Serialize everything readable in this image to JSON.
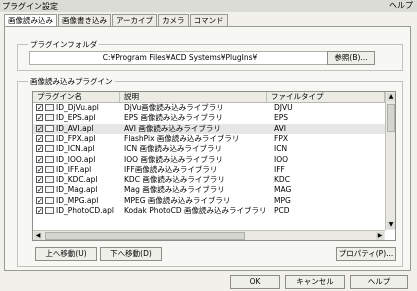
{
  "window": {
    "title": "プラグイン設定",
    "help_label": "ヘルプ"
  },
  "tabs": [
    {
      "label": "画像読み込み"
    },
    {
      "label": "画像書き込み"
    },
    {
      "label": "アーカイブ"
    },
    {
      "label": "カメラ"
    },
    {
      "label": "コマンド"
    }
  ],
  "plugin_folder": {
    "caption": "プラグインフォルダ",
    "path": "C:¥Program Files¥ACD Systems¥PlugIns¥",
    "browse_label": "参照(B)..."
  },
  "reader_plugins": {
    "caption": "画像読み込みプラグイン",
    "columns": [
      "プラグイン名",
      "説明",
      "ファイルタイプ"
    ],
    "rows": [
      {
        "name": "ID_DjVu.apl",
        "desc": "DjVu画像読み込みライブラリ",
        "type": "DJVU",
        "checked": true
      },
      {
        "name": "ID_EPS.apl",
        "desc": "EPS 画像読み込みライブラリ",
        "type": "EPS",
        "checked": true
      },
      {
        "name": "ID_AVI.apl",
        "desc": "AVI 画像読み込みライブラリ",
        "type": "AVI",
        "checked": true,
        "selected": true
      },
      {
        "name": "ID_FPX.apl",
        "desc": "FlashPix 画像読み込みライブラリ",
        "type": "FPX",
        "checked": true
      },
      {
        "name": "ID_ICN.apl",
        "desc": "ICN 画像読み込みライブラリ",
        "type": "ICN",
        "checked": true
      },
      {
        "name": "ID_IOO.apl",
        "desc": "IOO 画像読み込みライブラリ",
        "type": "IOO",
        "checked": true
      },
      {
        "name": "ID_IFF.apl",
        "desc": "IFF画像読み込みライブラリ",
        "type": "IFF",
        "checked": true
      },
      {
        "name": "ID_KDC.apl",
        "desc": "KDC 画像読み込みライブラリ",
        "type": "KDC",
        "checked": true
      },
      {
        "name": "ID_Mag.apl",
        "desc": "Mag 画像読み込みライブラリ",
        "type": "MAG",
        "checked": true
      },
      {
        "name": "ID_MPG.apl",
        "desc": "MPEG 画像読み込みライブラリ",
        "type": "MPG",
        "checked": true
      },
      {
        "name": "ID_PhotoCD.apl",
        "desc": "Kodak PhotoCD 画像読み込みライブラリ",
        "type": "PCD",
        "checked": true
      }
    ]
  },
  "buttons": {
    "move_up": "上へ移動(U)",
    "move_down": "下へ移動(D)",
    "properties": "プロパティ(P)..."
  },
  "footer": {
    "ok": "OK",
    "cancel": "キャンセル",
    "help": "ヘルプ"
  }
}
